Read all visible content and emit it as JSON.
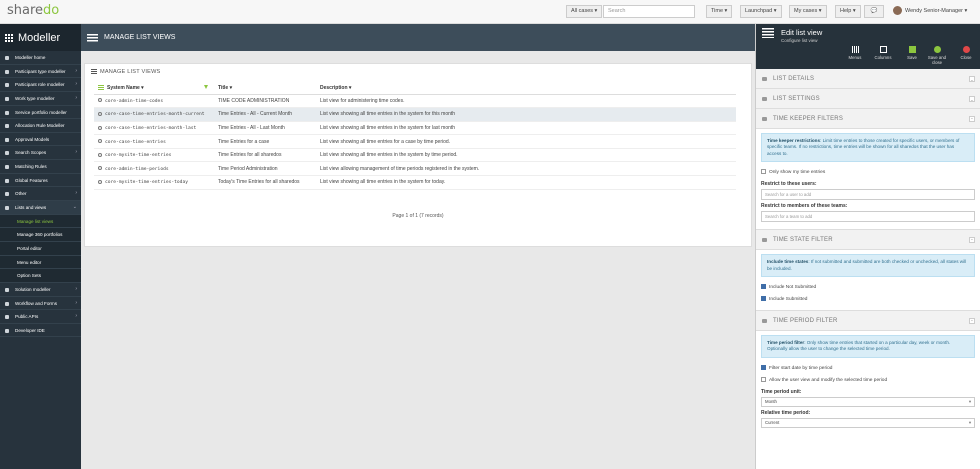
{
  "topbar": {
    "logo_a": "share",
    "logo_b": "do",
    "all_cases": "All cases ▾",
    "search_placeholder": "Search",
    "time": "Time ▾",
    "launchpad": "Launchpad ▾",
    "my_cases": "My cases ▾",
    "help": "Help ▾",
    "user": "Wendy Senior-Manager ▾"
  },
  "sidebar": {
    "title": "Modeller",
    "items": [
      {
        "label": "Modeller home",
        "chev": ""
      },
      {
        "label": "Participant type modeller",
        "chev": "›"
      },
      {
        "label": "Participant role modeller",
        "chev": "›"
      },
      {
        "label": "Work type modeller",
        "chev": "›"
      },
      {
        "label": "Service portfolio modeller",
        "chev": ""
      },
      {
        "label": "Allocation Rule Modeller",
        "chev": ""
      },
      {
        "label": "Approval Models",
        "chev": ""
      },
      {
        "label": "Search Scopes",
        "chev": "›"
      },
      {
        "label": "Matching Rules",
        "chev": ""
      },
      {
        "label": "Global Features",
        "chev": ""
      },
      {
        "label": "Other",
        "chev": "›"
      },
      {
        "label": "Lists and views",
        "chev": "⌄"
      },
      {
        "label": "Manage list views",
        "chev": ""
      },
      {
        "label": "Manage 360 portfolios",
        "chev": ""
      },
      {
        "label": "Portal editor",
        "chev": ""
      },
      {
        "label": "Menu editor",
        "chev": ""
      },
      {
        "label": "Option Sets",
        "chev": ""
      },
      {
        "label": "Solution modeller",
        "chev": "›"
      },
      {
        "label": "Workflow and Forms",
        "chev": "›"
      },
      {
        "label": "Public APIs",
        "chev": "›"
      },
      {
        "label": "Developer IDE",
        "chev": ""
      }
    ]
  },
  "main": {
    "header": "MANAGE LIST VIEWS",
    "panel_title": "MANAGE LIST VIEWS",
    "columns": [
      "System Name ▾",
      "Title ▾",
      "Description ▾"
    ],
    "rows": [
      {
        "system": "core-admin-time-codes",
        "title": "TIME CODE ADMINISTRATION",
        "desc": "List view for administering time codes."
      },
      {
        "system": "core-case-time-entries-month-current",
        "title": "Time Entries - All - Current Month",
        "desc": "List view showing all time entries in the system for this month"
      },
      {
        "system": "core-case-time-entries-month-last",
        "title": "Time Entries - All - Last Month",
        "desc": "List view showing all time entries in the system for last month"
      },
      {
        "system": "core-case-time-entries",
        "title": "Time Entries for a case",
        "desc": "List view showing all time entries for a case by time period."
      },
      {
        "system": "core-mysite-time-entries",
        "title": "Time Entries for all sharedos",
        "desc": "List view showing all time entries in the system by time period."
      },
      {
        "system": "core-admin-time-periods",
        "title": "Time Period Administration",
        "desc": "List view allowing management of time periods registered in the system."
      },
      {
        "system": "core-mysite-time-entries-today",
        "title": "Today's Time Entries for all sharedos",
        "desc": "List view showing all time entries in the system for today."
      }
    ],
    "pager": "Page 1 of 1 (7 records)"
  },
  "right": {
    "title": "Edit list view",
    "subtitle": "Configure list view",
    "tools": [
      "Menus",
      "Columns",
      "Save",
      "Save and close",
      "Close"
    ],
    "sections": {
      "list_details": "LIST DETAILS",
      "list_settings": "LIST SETTINGS",
      "time_keeper": "TIME KEEPER FILTERS",
      "time_state": "TIME STATE FILTER",
      "time_period": "TIME PERIOD FILTER"
    },
    "tk_info_b": "Time keeper restrictions",
    "tk_info": ": Limit time entries to those created for specific users, or members of specific teams. If no restrictions, time entries will be shown for all sharedos that the user has access to.",
    "only_mine": "Only show my time entries",
    "restrict_users_label": "Restrict to these users:",
    "restrict_users_ph": "Search for a user to add",
    "restrict_teams_label": "Restrict to members of these teams:",
    "restrict_teams_ph": "Search for a team to add",
    "ts_info_b": "Include time states",
    "ts_info": ": If not submitted and submitted are both checked or unchecked, all states will be included.",
    "include_not_submitted": "Include Not Submitted",
    "include_submitted": "Include Submitted",
    "tp_info_b": "Time period filter",
    "tp_info": ": Only show time entries that started on a particular day, week or month. Optionally allow the user to change the selected time period.",
    "filter_start": "Filter start date by time period",
    "allow_user": "Allow the user view and modify the selected time period",
    "unit_label": "Time period unit:",
    "unit_value": "Month",
    "relative_label": "Relative time period:",
    "relative_value": "Current",
    "colors": {
      "accent": "#8cc63f",
      "sidebar": "#27333d",
      "header": "#3d4d5a"
    }
  }
}
